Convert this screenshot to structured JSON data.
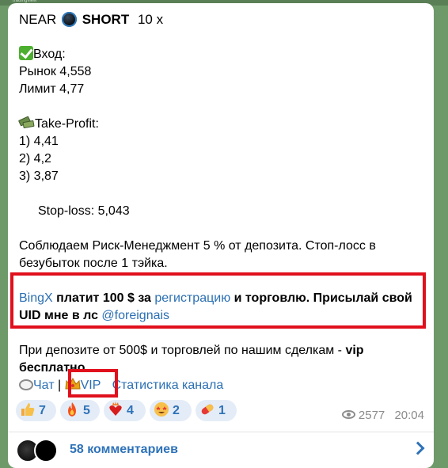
{
  "topbar": {
    "text": "tradingview"
  },
  "message": {
    "coin": "NEAR",
    "direction": "SHORT",
    "leverage": "10 x",
    "entry_label": "Вход:",
    "market": "Рынок 4,558",
    "limit": "Лимит 4,77",
    "tp_label": "Take-Profit:",
    "tp": [
      "1) 4,41",
      "2) 4,2",
      "3) 3,87"
    ],
    "stop_loss": "Stop-loss: 5,043",
    "risk_text": "Соблюдаем Риск-Менеджмент 5 % от депозита. Стоп-лосс в",
    "risk_text2": "безубыток после 1 тэйка.",
    "promo": {
      "bingx": "BingX",
      "pays": " платит 100 $ за ",
      "registration": "регистрацию",
      "trade": " и торговлю. Присылай свой",
      "uid": "UID мне в лс ",
      "handle": "@foreignais"
    },
    "vip_text1": "При депозите от 500$ и торговлей по нашим сделкам - ",
    "vip_bold": "vip",
    "vip_text2": "бесплатно",
    "links": {
      "chat": "Чат",
      "sep": "|",
      "vip": "VIP",
      "stats": "Статистика канала"
    }
  },
  "reactions": [
    {
      "icon": "thumbs-up-icon",
      "count": "7"
    },
    {
      "icon": "fire-icon",
      "count": "5"
    },
    {
      "icon": "heart-on-fire-icon",
      "count": "4"
    },
    {
      "icon": "star-struck-icon",
      "count": "2"
    },
    {
      "icon": "pill-icon",
      "count": "1"
    }
  ],
  "meta": {
    "views": "2577",
    "time": "20:04"
  },
  "comments": {
    "label": "58 комментариев"
  },
  "colors": {
    "link": "#2b6fb3",
    "highlight": "#e0101c",
    "reaction_bg": "#e4ecf7"
  }
}
